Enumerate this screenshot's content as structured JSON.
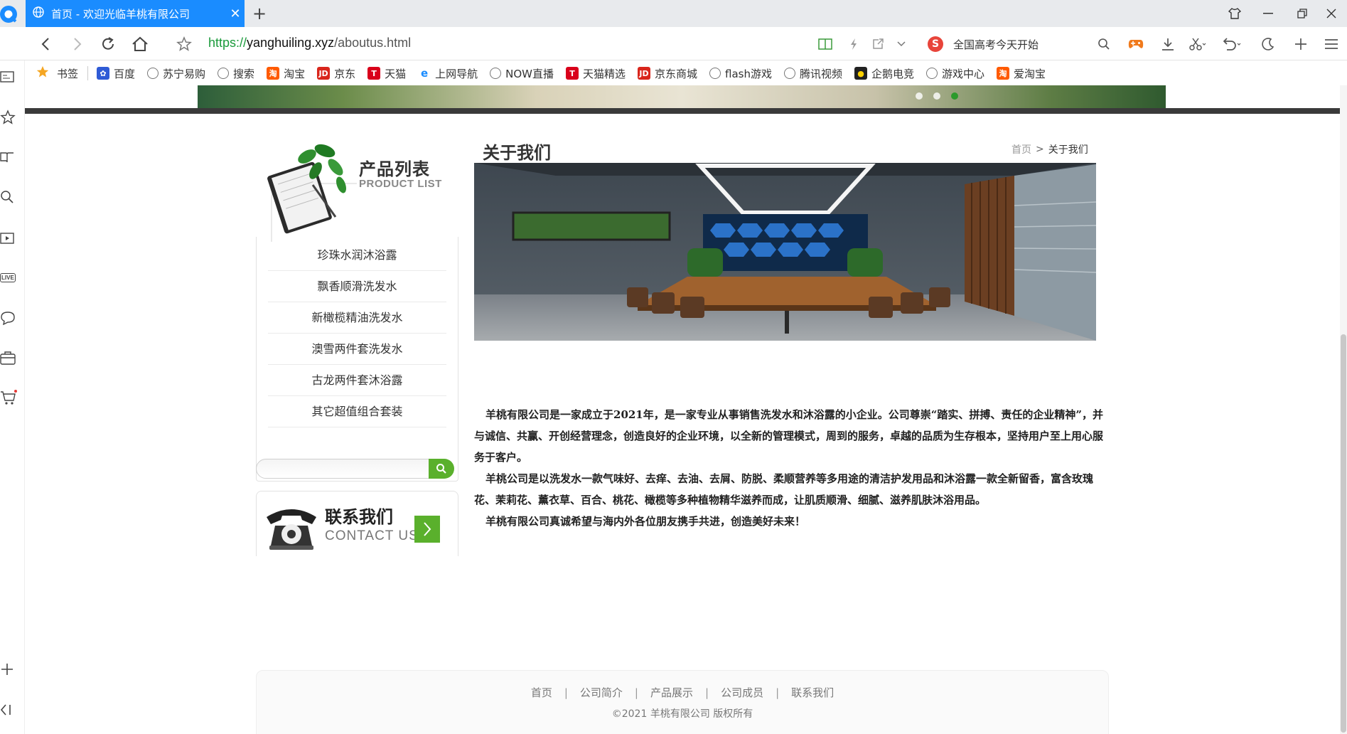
{
  "browser": {
    "tab_title": "首页 - 欢迎光临羊桃有限公司",
    "url_scheme": "https://",
    "url_host": "yanghuiling.xyz",
    "url_path": "/aboutus.html",
    "search_suggestion": "全国高考今天开始",
    "accent": "#1a8cff"
  },
  "bookmarks": [
    {
      "label": "书签",
      "icon": "star-icon"
    },
    {
      "label": "百度",
      "icon": "baidu-icon"
    },
    {
      "label": "苏宁易购",
      "icon": "globe-icon"
    },
    {
      "label": "搜索",
      "icon": "globe-icon"
    },
    {
      "label": "淘宝",
      "icon": "taobao-icon"
    },
    {
      "label": "京东",
      "icon": "jd-icon"
    },
    {
      "label": "天猫",
      "icon": "tmall-icon"
    },
    {
      "label": "上网导航",
      "icon": "ie-icon"
    },
    {
      "label": "NOW直播",
      "icon": "globe-icon"
    },
    {
      "label": "天猫精选",
      "icon": "tmall-icon"
    },
    {
      "label": "京东商城",
      "icon": "jd-icon"
    },
    {
      "label": "flash游戏",
      "icon": "globe-icon"
    },
    {
      "label": "腾讯视频",
      "icon": "globe-icon"
    },
    {
      "label": "企鹅电竞",
      "icon": "penguin-icon"
    },
    {
      "label": "游戏中心",
      "icon": "globe-icon"
    },
    {
      "label": "爱淘宝",
      "icon": "taobao-icon"
    }
  ],
  "sidebar": {
    "live_label": "LIVE"
  },
  "product_list": {
    "title": "产品列表",
    "subtitle": "PRODUCT LIST",
    "items": [
      "珍珠水润沐浴露",
      "飘香顺滑洗发水",
      "新橄榄精油洗发水",
      "澳雪两件套洗发水",
      "古龙两件套沐浴露",
      "其它超值组合套装"
    ]
  },
  "search": {
    "placeholder": ""
  },
  "contact": {
    "title": "联系我们",
    "subtitle": "CONTACT US"
  },
  "main": {
    "title": "关于我们",
    "breadcrumb_home": "首页",
    "breadcrumb_sep": ">",
    "breadcrumb_current": "关于我们",
    "paragraphs": [
      "羊桃有限公司是一家成立于2021年，是一家专业从事销售洗发水和沐浴露的小企业。公司尊崇“踏实、拼搏、责任的企业精神”，并与诚信、共赢、开创经营理念，创造良好的企业环境，以全新的管理模式，周到的服务，卓越的品质为生存根本，坚持用户至上用心服务于客户。",
      "羊桃公司是以洗发水一款气味好、去痒、去油、去屑、防脱、柔顺营养等多用途的清洁护发用品和沐浴露一款全新留香，富含玫瑰花、茉莉花、薰衣草、百合、桃花、橄榄等多种植物精华滋养而成，让肌质顺滑、细腻、滋养肌肤沐浴用品。",
      "羊桃有限公司真诚希望与海内外各位朋友携手共进，创造美好未来！"
    ]
  },
  "footer": {
    "nav": [
      "首页",
      "公司简介",
      "产品展示",
      "公司成员",
      "联系我们"
    ],
    "separator": "|",
    "copyright": "©2021  羊桃有限公司  版权所有"
  },
  "colors": {
    "green": "#5ab02c",
    "dark_line": "#3a3a3a"
  }
}
